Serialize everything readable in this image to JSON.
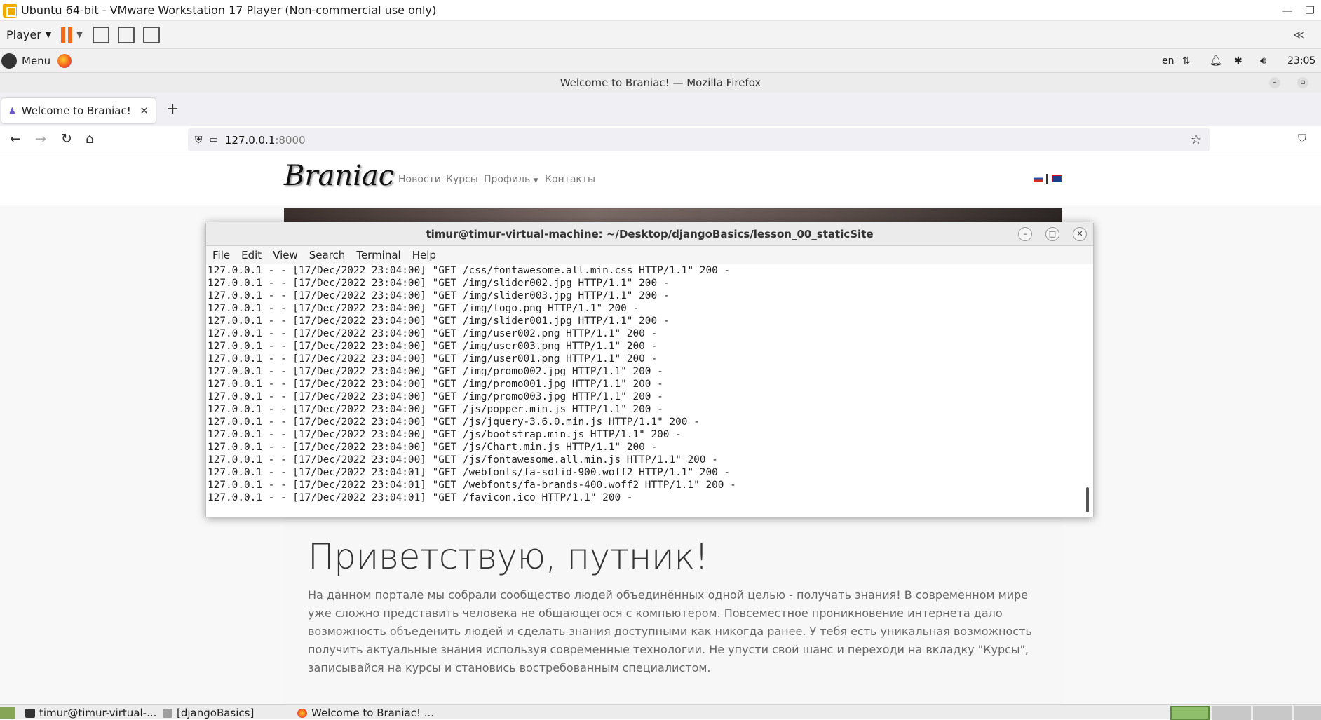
{
  "vm": {
    "title": "Ubuntu 64-bit - VMware Workstation 17 Player (Non-commercial use only)",
    "player_label": "Player"
  },
  "panel": {
    "menu_label": "Menu",
    "lang": "en",
    "clock": "23:05"
  },
  "firefox": {
    "window_title": "Welcome to Braniac! — Mozilla Firefox",
    "tab_title": "Welcome to Braniac!",
    "url_host": "127.0.0.1",
    "url_port": ":8000"
  },
  "site": {
    "brand": "Braniac",
    "nav": [
      "Новости",
      "Курсы",
      "Профиль",
      "Контакты"
    ],
    "heading": "Приветствую, путник!",
    "paragraph": "На данном портале мы собрали сообщество людей объединённых одной целью - получать знания! В современном мире уже сложно представить человека не общающегося с компьютером. Повсеместное проникновение интернета дало возможность объеденить людей и сделать знания доступными как никогда ранее. У тебя есть уникальная возможность получить актуальные знания используя современные технологии. Не упусти свой шанс и переходи на вкладку \"Курсы\", записывайся на курсы и становись востребованным специалистом."
  },
  "terminal": {
    "title": "timur@timur-virtual-machine: ~/Desktop/djangoBasics/lesson_00_staticSite",
    "menu": [
      "File",
      "Edit",
      "View",
      "Search",
      "Terminal",
      "Help"
    ],
    "lines": [
      "127.0.0.1 - - [17/Dec/2022 23:04:00] \"GET /css/fontawesome.all.min.css HTTP/1.1\" 200 -",
      "127.0.0.1 - - [17/Dec/2022 23:04:00] \"GET /img/slider002.jpg HTTP/1.1\" 200 -",
      "127.0.0.1 - - [17/Dec/2022 23:04:00] \"GET /img/slider003.jpg HTTP/1.1\" 200 -",
      "127.0.0.1 - - [17/Dec/2022 23:04:00] \"GET /img/logo.png HTTP/1.1\" 200 -",
      "127.0.0.1 - - [17/Dec/2022 23:04:00] \"GET /img/slider001.jpg HTTP/1.1\" 200 -",
      "127.0.0.1 - - [17/Dec/2022 23:04:00] \"GET /img/user002.png HTTP/1.1\" 200 -",
      "127.0.0.1 - - [17/Dec/2022 23:04:00] \"GET /img/user003.png HTTP/1.1\" 200 -",
      "127.0.0.1 - - [17/Dec/2022 23:04:00] \"GET /img/user001.png HTTP/1.1\" 200 -",
      "127.0.0.1 - - [17/Dec/2022 23:04:00] \"GET /img/promo002.jpg HTTP/1.1\" 200 -",
      "127.0.0.1 - - [17/Dec/2022 23:04:00] \"GET /img/promo001.jpg HTTP/1.1\" 200 -",
      "127.0.0.1 - - [17/Dec/2022 23:04:00] \"GET /img/promo003.jpg HTTP/1.1\" 200 -",
      "127.0.0.1 - - [17/Dec/2022 23:04:00] \"GET /js/popper.min.js HTTP/1.1\" 200 -",
      "127.0.0.1 - - [17/Dec/2022 23:04:00] \"GET /js/jquery-3.6.0.min.js HTTP/1.1\" 200 -",
      "127.0.0.1 - - [17/Dec/2022 23:04:00] \"GET /js/bootstrap.min.js HTTP/1.1\" 200 -",
      "127.0.0.1 - - [17/Dec/2022 23:04:00] \"GET /js/Chart.min.js HTTP/1.1\" 200 -",
      "127.0.0.1 - - [17/Dec/2022 23:04:00] \"GET /js/fontawesome.all.min.js HTTP/1.1\" 200 -",
      "127.0.0.1 - - [17/Dec/2022 23:04:01] \"GET /webfonts/fa-solid-900.woff2 HTTP/1.1\" 200 -",
      "127.0.0.1 - - [17/Dec/2022 23:04:01] \"GET /webfonts/fa-brands-400.woff2 HTTP/1.1\" 200 -",
      "127.0.0.1 - - [17/Dec/2022 23:04:01] \"GET /favicon.ico HTTP/1.1\" 200 -"
    ]
  },
  "taskbar": {
    "items": [
      "timur@timur-virtual-...",
      "[djangoBasics]",
      "Welcome to Braniac! ..."
    ]
  },
  "colors": {
    "accent_orange": "#f26b1d",
    "brand_text": "#111111"
  }
}
